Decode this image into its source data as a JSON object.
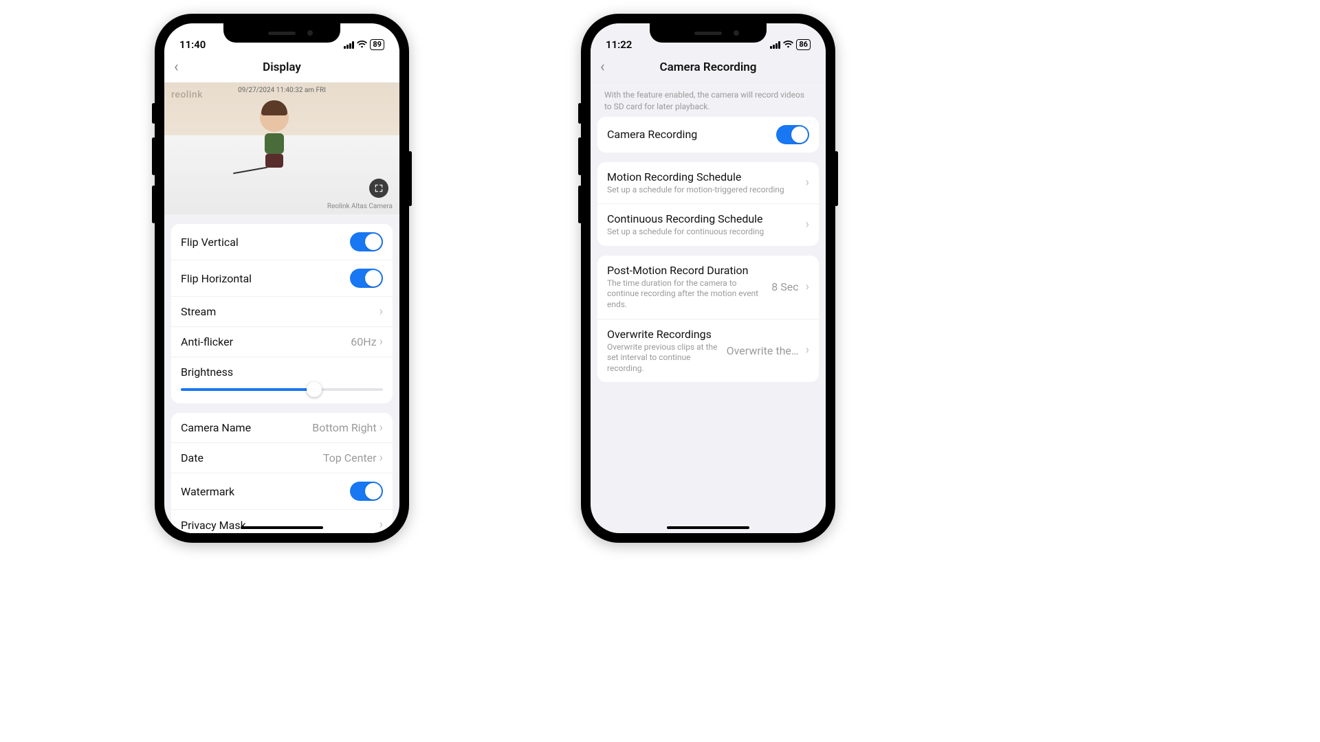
{
  "phone1": {
    "status": {
      "time": "11:40",
      "battery": "89"
    },
    "header": {
      "title": "Display"
    },
    "preview": {
      "watermark_logo": "reolink",
      "timestamp": "09/27/2024 11:40:32 am FRI",
      "camera_label": "Reolink Altas Camera"
    },
    "settings1": {
      "flip_vertical": {
        "label": "Flip Vertical",
        "on": true
      },
      "flip_horizontal": {
        "label": "Flip Horizontal",
        "on": true
      },
      "stream": {
        "label": "Stream"
      },
      "anti_flicker": {
        "label": "Anti-flicker",
        "value": "60Hz"
      },
      "brightness": {
        "label": "Brightness",
        "percent": 66
      }
    },
    "settings2": {
      "camera_name": {
        "label": "Camera Name",
        "value": "Bottom Right"
      },
      "date": {
        "label": "Date",
        "value": "Top Center"
      },
      "watermark": {
        "label": "Watermark",
        "on": true
      },
      "privacy_mask": {
        "label": "Privacy Mask"
      }
    }
  },
  "phone2": {
    "status": {
      "time": "11:22",
      "battery": "86"
    },
    "header": {
      "title": "Camera Recording"
    },
    "intro": "With the feature enabled, the camera will record videos to SD card for later playback.",
    "recording_toggle": {
      "label": "Camera Recording",
      "on": true
    },
    "schedules": {
      "motion": {
        "title": "Motion Recording Schedule",
        "sub": "Set up a schedule for motion-triggered recording"
      },
      "continuous": {
        "title": "Continuous Recording Schedule",
        "sub": "Set up a schedule for continuous recording"
      }
    },
    "options": {
      "post_motion": {
        "title": "Post-Motion Record Duration",
        "sub": "The time duration for the camera to continue recording after the motion event ends.",
        "value": "8 Sec"
      },
      "overwrite": {
        "title": "Overwrite Recordings",
        "sub": "Overwrite previous clips at the set interval to continue recording.",
        "value": "Overwrite the…"
      }
    }
  }
}
